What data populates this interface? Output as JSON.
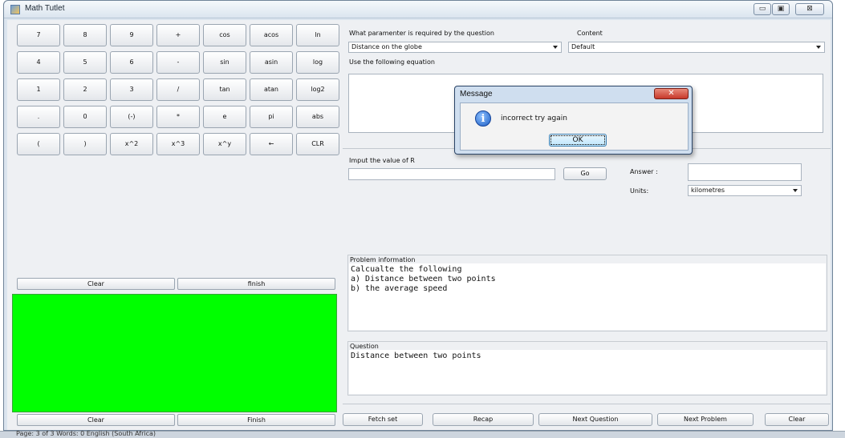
{
  "window": {
    "title": "Math Tutlet",
    "min_label": "▭",
    "max_label": "▣",
    "close_label": "⊠"
  },
  "calculator": {
    "rows": [
      [
        "7",
        "8",
        "9",
        "+",
        "cos",
        "acos",
        "ln"
      ],
      [
        "4",
        "5",
        "6",
        "-",
        "sin",
        "asin",
        "log"
      ],
      [
        "1",
        "2",
        "3",
        "/",
        "tan",
        "atan",
        "log2"
      ],
      [
        ".",
        "0",
        "(-)",
        "*",
        "e",
        "pi",
        "abs"
      ],
      [
        "(",
        ")",
        "x^2",
        "x^3",
        "x^y",
        "←",
        "CLR"
      ]
    ],
    "clear_label": "Clear",
    "finish_label": "finish"
  },
  "bottom_left": {
    "clear_label": "Clear",
    "finish_label": "Finish"
  },
  "question_panel": {
    "parameter_label": "What paramenter is required by the question",
    "content_label": "Content",
    "parameter_value": "Distance on the globe",
    "content_value": "Default",
    "equation_label": "Use the following equation"
  },
  "input_panel": {
    "input_label": "Imput the value of R",
    "go_label": "Go",
    "answer_label": "Answer :",
    "units_label": "Units:",
    "units_value": "kilometres"
  },
  "problem_info": {
    "header": "Problem information",
    "lines": [
      "Calcualte the following",
      "a) Distance between two points",
      "b) the average speed"
    ]
  },
  "question": {
    "header": "Question",
    "text": "Distance between two points"
  },
  "bottom_buttons": {
    "fetch": "Fetch set",
    "recap": "Recap",
    "next_question": "Next Question",
    "next_problem": "Next Problem",
    "clear": "Clear"
  },
  "dialog": {
    "title": "Message",
    "message": "incorrect try again",
    "ok": "OK",
    "close": "✕"
  },
  "taskbar": {
    "text": "Page: 3 of 3    Words: 0    English (South Africa)"
  }
}
